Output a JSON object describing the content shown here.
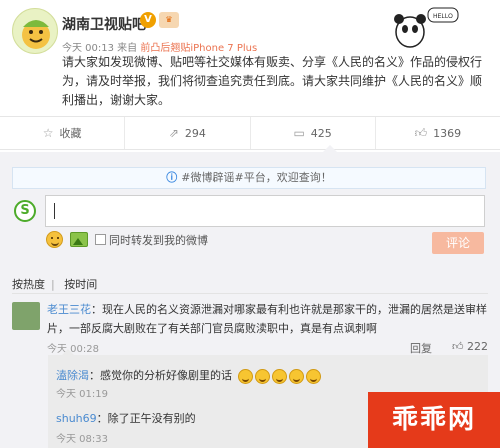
{
  "post": {
    "username": "湖南卫视贴吧",
    "v_badge": "V",
    "meta_time": "今天 00:13 来自",
    "meta_source": "前凸后翘贴iPhone 7 Plus",
    "body": "请大家如发现微博、贴吧等社交媒体有贩卖、分享《人民的名义》作品的侵权行为，请及时举报，我们将彻查追究责任到底。请大家共同维护《人民的名义》顺利播出，谢谢大家。"
  },
  "actions": [
    {
      "icon": "star-icon",
      "label": "收藏"
    },
    {
      "icon": "share-icon",
      "label": "294"
    },
    {
      "icon": "comment-icon",
      "label": "425"
    },
    {
      "icon": "like-icon",
      "label": "1369"
    }
  ],
  "notice": "#微博辟谣#平台，欢迎查询！",
  "compose": {
    "sync_label": "同时转发到我的微博",
    "submit_label": "评论"
  },
  "sort": {
    "hot": "按热度",
    "time": "按时间"
  },
  "comments": [
    {
      "nick": "老王三花",
      "text": "：现在人民的名义资源泄漏对哪家最有利也许就是那家干的，泄漏的居然是送审样片，一部反腐大剧败在了有关部门官员腐败渎职中，真是有点讽刺啊",
      "time": "今天 00:28",
      "reply": "回复",
      "likes": "222"
    }
  ],
  "replies": [
    {
      "nick": "溘除渴",
      "text": "：感觉你的分析好像剧里的话",
      "time": "今天 01:19"
    },
    {
      "nick": "shuh69",
      "text": "：除了正午没有别的",
      "time": "今天 08:33"
    }
  ],
  "watermark": "乖乖网"
}
